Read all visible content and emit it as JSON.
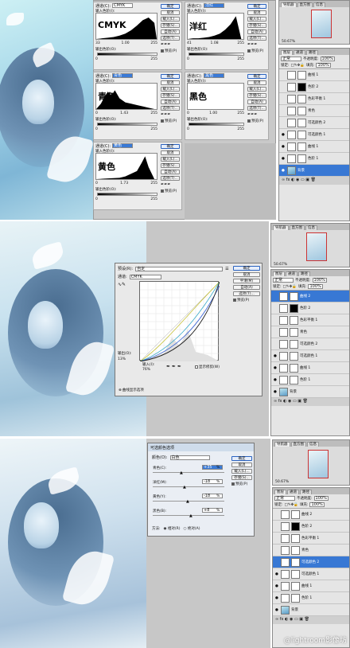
{
  "panel1": {
    "levels": [
      {
        "channel_label": "通道(C):",
        "channel": "CMYK",
        "big_label": "CMYK",
        "input_label": "输入色阶(I):",
        "in_left": "33",
        "in_mid": "1.00",
        "in_right": "255",
        "output_label": "输出色阶(O):",
        "out_left": "0",
        "out_right": "255",
        "buttons": [
          "确定",
          "取消",
          "载入(L)...",
          "存储(S)...",
          "自动(A)",
          "选项(T)..."
        ],
        "preview": "预览(P)"
      },
      {
        "channel_label": "通道(C):",
        "channel": "洋红",
        "big_label": "洋红",
        "input_label": "输入色阶(I):",
        "in_left": "41",
        "in_mid": "1.08",
        "in_right": "255",
        "output_label": "输出色阶(O):",
        "out_left": "0",
        "out_right": "255",
        "buttons": [
          "确定",
          "取消",
          "载入(L)...",
          "存储(S)...",
          "自动(A)",
          "选项(T)..."
        ],
        "preview": "预览(P)"
      },
      {
        "channel_label": "通道(C):",
        "channel": "青色",
        "big_label": "青色",
        "input_label": "输入色阶(I):",
        "in_left": "0",
        "in_mid": "1.43",
        "in_right": "255",
        "output_label": "输出色阶(O):",
        "out_left": "0",
        "out_right": "255",
        "buttons": [
          "确定",
          "取消",
          "载入(L)...",
          "存储(S)...",
          "自动(A)",
          "选项(T)..."
        ],
        "preview": "预览(P)"
      },
      {
        "channel_label": "通道(C):",
        "channel": "黑色",
        "big_label": "黑色",
        "input_label": "输入色阶(I):",
        "in_left": "0",
        "in_mid": "1.00",
        "in_right": "255",
        "output_label": "输出色阶(O):",
        "out_left": "0",
        "out_right": "255",
        "buttons": [
          "确定",
          "取消",
          "载入(L)...",
          "存储(S)...",
          "自动(A)",
          "选项(T)..."
        ],
        "preview": "预览(P)"
      },
      {
        "channel_label": "通道(C):",
        "channel": "黄色",
        "big_label": "黄色",
        "input_label": "输入色阶(I):",
        "in_left": "0",
        "in_mid": "1.73",
        "in_right": "255",
        "output_label": "输出色阶(O):",
        "out_left": "0",
        "out_right": "255",
        "buttons": [
          "确定",
          "取消",
          "载入(L)...",
          "存储(S)...",
          "自动(A)",
          "选项(T)..."
        ],
        "preview": "预览(P)"
      }
    ],
    "nav_tabs": [
      "导航器",
      "直方图",
      "信息"
    ],
    "zoom": "50.67%",
    "layer_tabs": [
      "图层",
      "通道",
      "路径"
    ],
    "blend": "正常",
    "opacity_label": "不透明度:",
    "opacity": "100%",
    "fill_label": "填充:",
    "fill": "100%",
    "lock_label": "锁定:",
    "layers": [
      "曲线 1",
      "色阶 2",
      "色彩平衡 1",
      "青色",
      "可选颜色 2",
      "可选颜色 1",
      "曲线 1",
      "色阶 1",
      "背景"
    ]
  },
  "panel2": {
    "preset_label": "预设(R):",
    "preset": "自定",
    "channel_label": "通道:",
    "channel": "CMYK",
    "buttons": [
      "确定",
      "取消",
      "平滑(M)",
      "自动(A)",
      "选项(T)..."
    ],
    "preview": "预览(P)",
    "output_label": "输出(O):",
    "output_value": "13%",
    "input_label": "输入(I):",
    "input_value": "76%",
    "clip_label": "显示修剪(W)",
    "display_label": "曲线显示选项",
    "nav_tabs": [
      "导航器",
      "直方图",
      "信息"
    ],
    "zoom": "50.67%",
    "layer_tabs": [
      "图层",
      "通道",
      "路径"
    ],
    "blend": "正常",
    "opacity_label": "不透明度:",
    "opacity": "100%",
    "fill_label": "填充:",
    "fill": "100%",
    "lock_label": "锁定:",
    "layers": [
      "曲线 2",
      "色阶 2",
      "色彩平衡 1",
      "青色",
      "可选颜色 2",
      "可选颜色 1",
      "曲线 1",
      "色阶 1",
      "背景"
    ]
  },
  "panel3": {
    "title": "可选颜色选项",
    "colors_label": "颜色(O):",
    "colors_value": "白色",
    "rows": [
      {
        "label": "青色(C):",
        "value": "+35",
        "unit": "%"
      },
      {
        "label": "洋红(M):",
        "value": "-18",
        "unit": "%"
      },
      {
        "label": "黄色(Y):",
        "value": "-18",
        "unit": "%"
      },
      {
        "label": "黑色(B):",
        "value": "+8",
        "unit": "%"
      }
    ],
    "method_label": "方法:",
    "relative": "相对(R)",
    "absolute": "绝对(A)",
    "buttons": [
      "确定",
      "取消",
      "载入(L)...",
      "存储(S)..."
    ],
    "preview": "预览(P)",
    "nav_tabs": [
      "导航器",
      "直方图",
      "信息"
    ],
    "zoom": "50.67%",
    "layer_tabs": [
      "图层",
      "通道",
      "路径"
    ],
    "blend": "正常",
    "opacity_label": "不透明度:",
    "opacity": "100%",
    "fill_label": "填充:",
    "fill": "100%",
    "lock_label": "锁定:",
    "layers": [
      "曲线 2",
      "色阶 2",
      "色彩平衡 1",
      "青色",
      "可选颜色 2",
      "可选颜色 1",
      "曲线 1",
      "色阶 1",
      "背景"
    ]
  },
  "watermark": "@lightroom影像坊",
  "colors": {
    "selection": "#3878d4",
    "curve_cyan": "#36a9c9",
    "curve_yellow": "#c7c23a",
    "curve_black": "#222222",
    "curve_blue": "#2f5bd3"
  }
}
